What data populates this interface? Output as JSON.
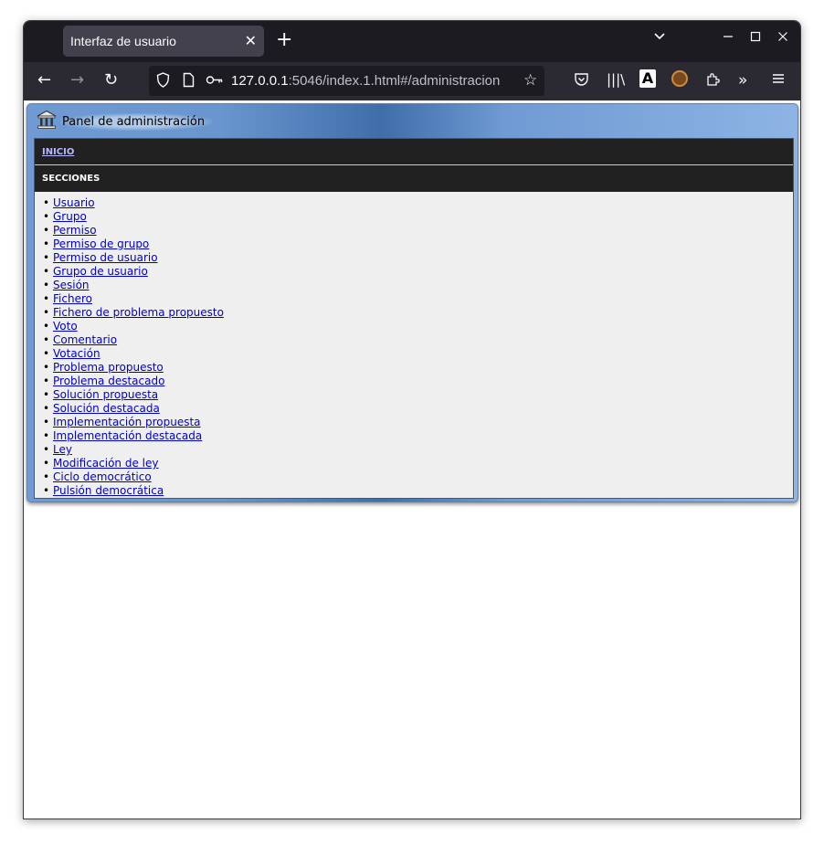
{
  "browser": {
    "tab_title": "Interfaz de usuario",
    "url_host": "127.0.0.1",
    "url_rest": ":5046/index.1.html#/administracion"
  },
  "icons": {
    "back": "arrow-left-icon",
    "forward": "arrow-right-icon",
    "reload": "reload-icon",
    "shield": "shield-icon",
    "page": "page-icon",
    "key": "key-icon",
    "bookmark": "star-icon",
    "pocket": "pocket-icon",
    "library": "library-icon",
    "reader": "font-icon",
    "extension_avatar": "extension-icon",
    "extensions": "puzzle-icon",
    "overflow": "chevron-double-right-icon",
    "menu": "hamburger-menu-icon",
    "panel": "bank-icon"
  },
  "panel": {
    "title": "Panel de administración",
    "inicio_label": "INICIO",
    "secciones_label": "SECCIONES",
    "items": [
      "Usuario",
      "Grupo",
      "Permiso",
      "Permiso de grupo",
      "Permiso de usuario",
      "Grupo de usuario",
      "Sesión",
      "Fichero",
      "Fichero de problema propuesto",
      "Voto",
      "Comentario",
      "Votación",
      "Problema propuesto",
      "Problema destacado",
      "Solución propuesta",
      "Solución destacada",
      "Implementación propuesta",
      "Implementación destacada",
      "Ley",
      "Modificación de ley",
      "Ciclo democrático",
      "Pulsión democrática"
    ]
  },
  "colors": {
    "tabbar": "#1c1b22",
    "navbar": "#2b2a33",
    "link": "#0000cc",
    "panel_dark_bar": "#212121",
    "panel_gradient_mid": "#3f6ea9"
  }
}
